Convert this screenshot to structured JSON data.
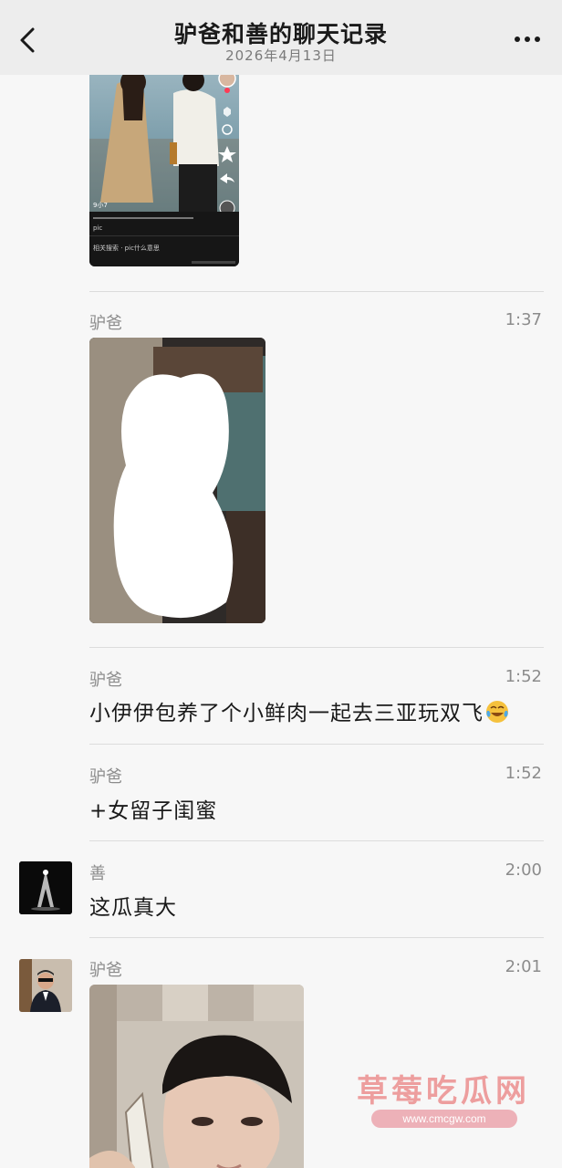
{
  "header": {
    "title": "驴爸和善的聊天记录",
    "subtitle": "2026年4月13日"
  },
  "messages": [
    {
      "sender": "驴爸",
      "time": "1:37",
      "type": "image"
    },
    {
      "sender": "驴爸",
      "time": "1:52",
      "text": "小伊伊包养了个小鲜肉一起去三亚玩双飞"
    },
    {
      "sender": "驴爸",
      "time": "1:52",
      "text": "+女留子闺蜜"
    },
    {
      "sender": "善",
      "time": "2:00",
      "text": "这瓜真大"
    },
    {
      "sender": "驴爸",
      "time": "2:01",
      "type": "image"
    }
  ],
  "first_image": {
    "profile_tag": "9小7",
    "music_label": "pic",
    "search_hint": "相关搜索 · pic什么意思"
  },
  "watermark": {
    "title": "草莓吃瓜网",
    "url": "www.cmcgw.com"
  },
  "colors": {
    "header_bg": "#ededed",
    "page_bg": "#f7f7f7",
    "secondary_text": "#8c8c8c"
  }
}
